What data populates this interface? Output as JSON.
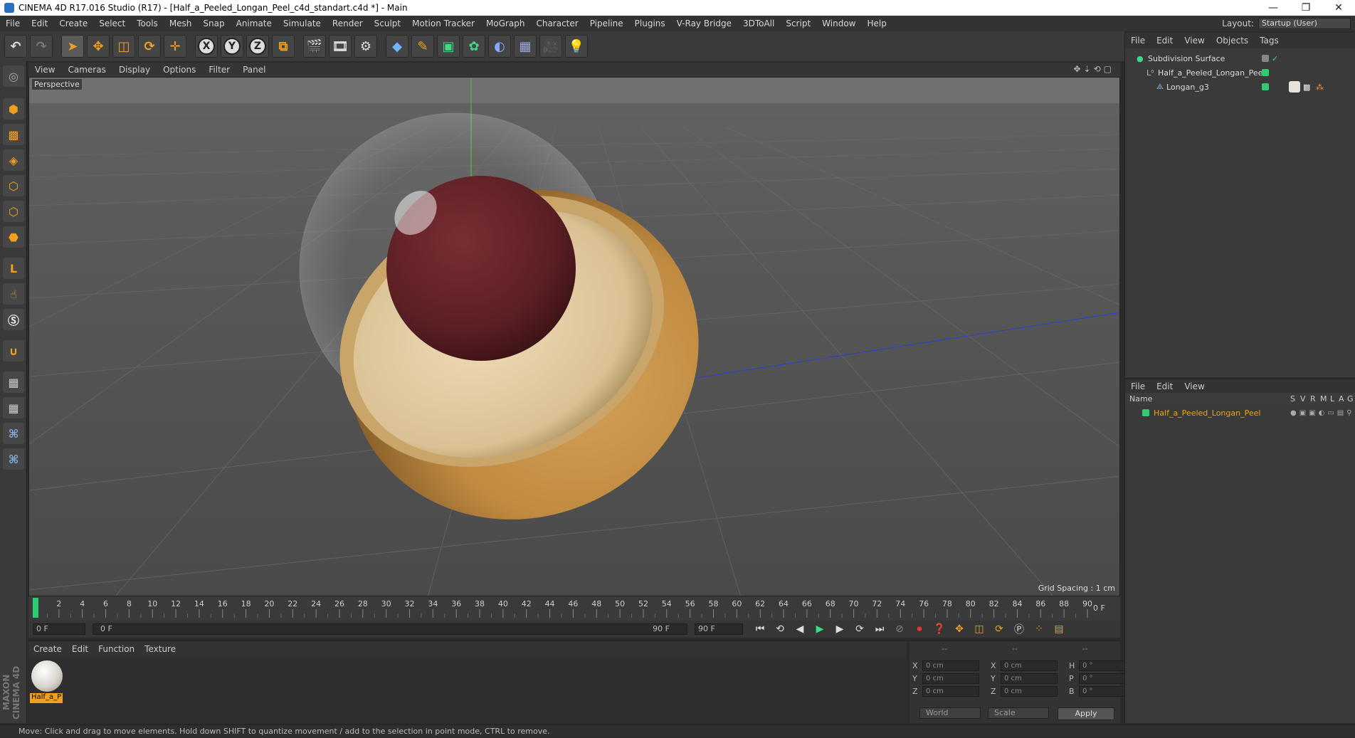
{
  "window": {
    "title": "CINEMA 4D R17.016 Studio (R17) - [Half_a_Peeled_Longan_Peel_c4d_standart.c4d *] - Main",
    "controls": [
      "—",
      "❐",
      "✕"
    ]
  },
  "menubar": [
    "File",
    "Edit",
    "Create",
    "Select",
    "Tools",
    "Mesh",
    "Snap",
    "Animate",
    "Simulate",
    "Render",
    "Sculpt",
    "Motion Tracker",
    "MoGraph",
    "Character",
    "Pipeline",
    "Plugins",
    "V-Ray Bridge",
    "3DToAll",
    "Script",
    "Window",
    "Help"
  ],
  "layout": {
    "label": "Layout:",
    "value": "Startup (User)"
  },
  "toolbar": {
    "axis_x": "X",
    "axis_y": "Y",
    "axis_z": "Z"
  },
  "viewport": {
    "menu": [
      "View",
      "Cameras",
      "Display",
      "Options",
      "Filter",
      "Panel"
    ],
    "label": "Perspective",
    "grid_spacing": "Grid Spacing : 1 cm"
  },
  "timeline": {
    "ticks": [
      "0",
      "2",
      "4",
      "6",
      "8",
      "10",
      "12",
      "14",
      "16",
      "18",
      "20",
      "22",
      "24",
      "26",
      "28",
      "30",
      "32",
      "34",
      "36",
      "38",
      "40",
      "42",
      "44",
      "46",
      "48",
      "50",
      "52",
      "54",
      "56",
      "58",
      "60",
      "62",
      "64",
      "66",
      "68",
      "70",
      "72",
      "74",
      "76",
      "78",
      "80",
      "82",
      "84",
      "86",
      "88",
      "90"
    ],
    "current_frame": "0 F",
    "start_field": "0 F",
    "range_start": "0 F",
    "range_end": "90 F",
    "end_field": "90 F"
  },
  "material_manager": {
    "menu": [
      "Create",
      "Edit",
      "Function",
      "Texture"
    ],
    "material_name": "Half_a_P"
  },
  "coordinates": {
    "header": [
      "--",
      "--",
      "--"
    ],
    "rows": [
      {
        "a": "X",
        "v1": "0 cm",
        "b": "X",
        "v2": "0 cm",
        "c": "H",
        "v3": "0 °"
      },
      {
        "a": "Y",
        "v1": "0 cm",
        "b": "Y",
        "v2": "0 cm",
        "c": "P",
        "v3": "0 °"
      },
      {
        "a": "Z",
        "v1": "0 cm",
        "b": "Z",
        "v2": "0 cm",
        "c": "B",
        "v3": "0 °"
      }
    ],
    "mode_world": "World",
    "mode_scale": "Scale",
    "apply": "Apply"
  },
  "object_manager": {
    "menu": [
      "File",
      "Edit",
      "View",
      "Objects",
      "Tags"
    ],
    "objects": [
      {
        "name": "Subdivision Surface",
        "indent": 0
      },
      {
        "name": "Half_a_Peeled_Longan_Peel",
        "indent": 1
      },
      {
        "name": "Longan_g3",
        "indent": 2
      }
    ]
  },
  "layer_manager": {
    "menu": [
      "File",
      "Edit",
      "View"
    ],
    "columns": {
      "name": "Name",
      "flags": [
        "S",
        "V",
        "R",
        "M",
        "L",
        "A",
        "G"
      ]
    },
    "layers": [
      {
        "name": "Half_a_Peeled_Longan_Peel"
      }
    ]
  },
  "statusbar": "Move: Click and drag to move elements. Hold down SHIFT to quantize movement / add to the selection in point mode, CTRL to remove.",
  "branding": "MAXON CINEMA 4D",
  "colors": {
    "accent": "#f0a020",
    "layer_green": "#2ecc71"
  }
}
